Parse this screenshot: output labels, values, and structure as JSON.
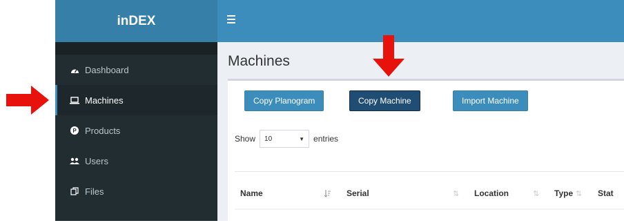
{
  "sidebar": {
    "brand": "inDEX",
    "items": [
      {
        "label": "Dashboard",
        "icon": "dashboard-icon"
      },
      {
        "label": "Machines",
        "icon": "laptop-icon"
      },
      {
        "label": "Products",
        "icon": "products-icon"
      },
      {
        "label": "Users",
        "icon": "users-icon"
      },
      {
        "label": "Files",
        "icon": "files-icon"
      }
    ]
  },
  "header": {
    "menu_icon": "hamburger-icon"
  },
  "main": {
    "title": "Machines",
    "buttons": {
      "copy_planogram": "Copy Planogram",
      "copy_machine": "Copy Machine",
      "import_machine": "Import Machine"
    },
    "show_entries": {
      "show": "Show",
      "value": "10",
      "entries": "entries"
    },
    "table": {
      "columns": [
        "Name",
        "Serial",
        "Location",
        "Type",
        "Stat"
      ]
    }
  },
  "colors": {
    "brand": "#367fa9",
    "topbar": "#3c8dbc",
    "sidebar": "#222d32",
    "annotation_arrow": "#e8120c"
  }
}
